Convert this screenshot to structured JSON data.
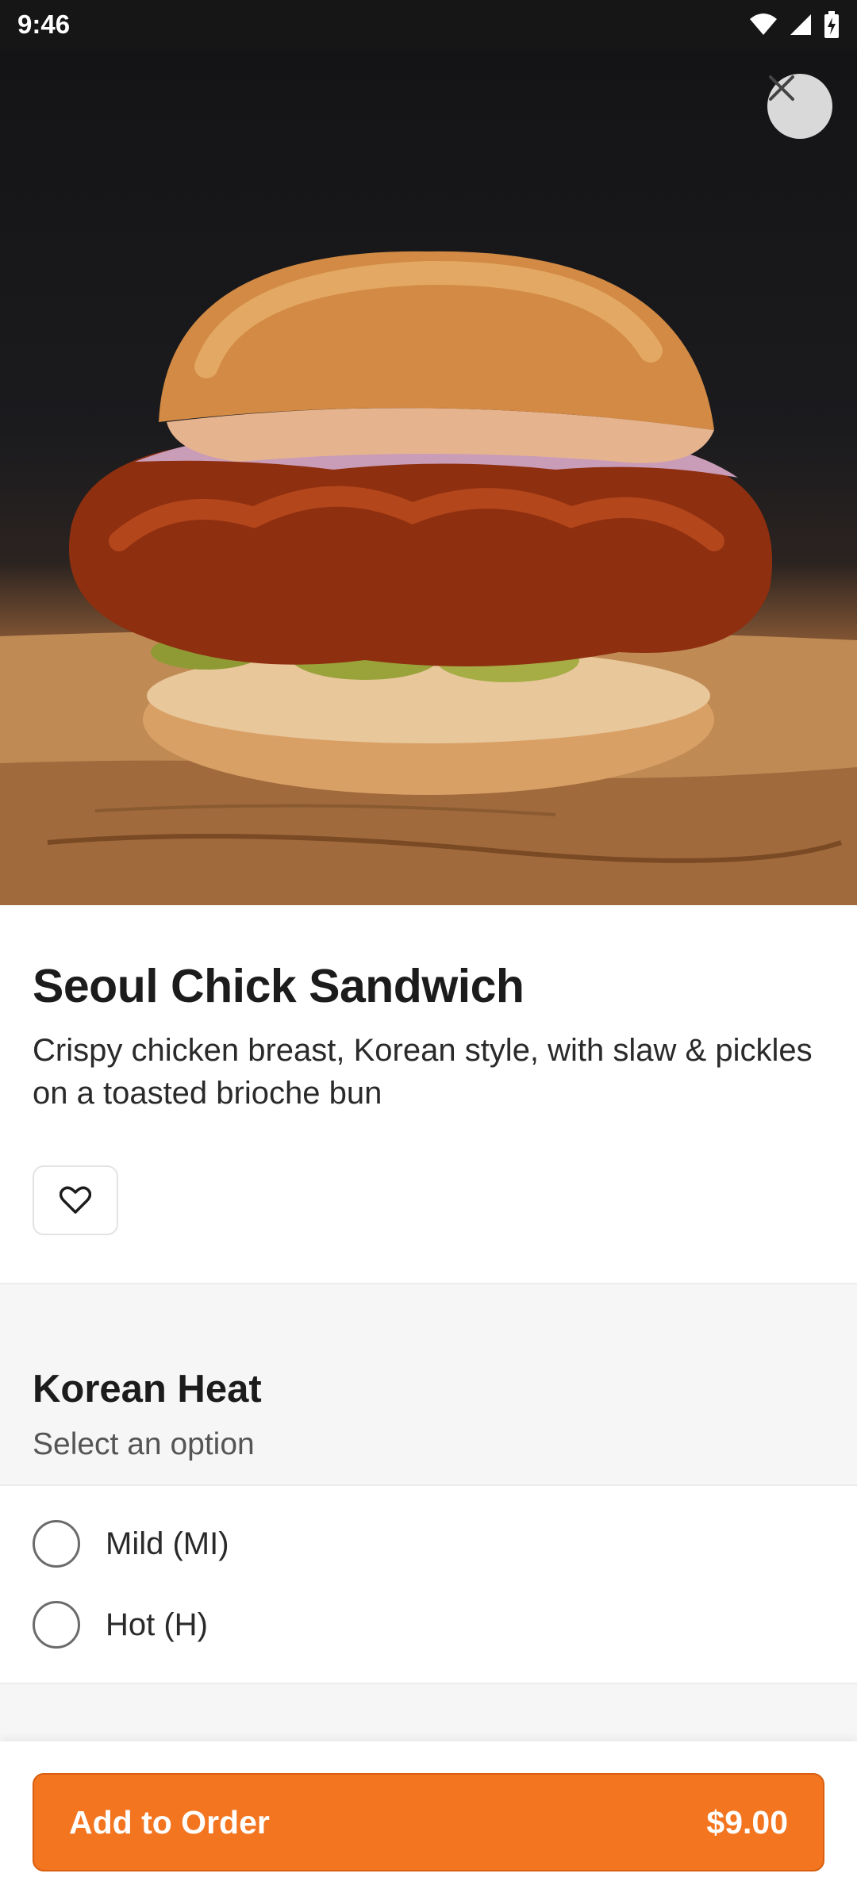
{
  "status_bar": {
    "time": "9:46"
  },
  "product": {
    "name": "Seoul Chick Sandwich",
    "description": "Crispy chicken breast, Korean style, with slaw & pickles on a toasted brioche bun"
  },
  "option_group": {
    "title": "Korean Heat",
    "subtitle": "Select an option",
    "options": [
      {
        "label": "Mild (MI)",
        "selected": false
      },
      {
        "label": "Hot (H)",
        "selected": false
      }
    ]
  },
  "cta": {
    "label": "Add to Order",
    "price": "$9.00"
  },
  "colors": {
    "accent": "#f37520",
    "status_bar": "#161616"
  }
}
